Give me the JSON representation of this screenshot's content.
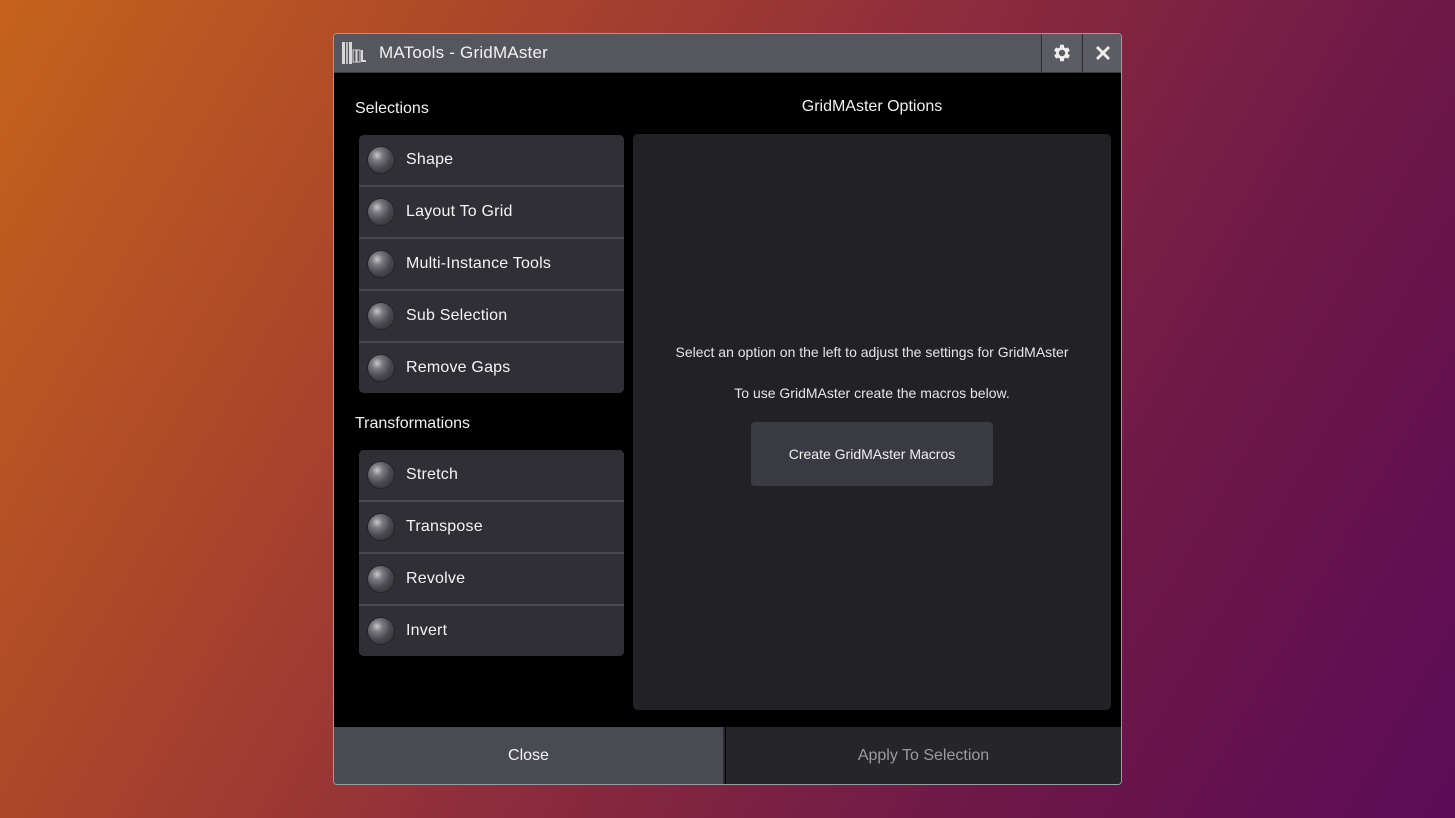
{
  "window": {
    "title": "MATools - GridMAster",
    "logo_icon": "matools-logo-icon",
    "settings_icon": "gear-icon",
    "close_icon": "close-icon"
  },
  "selections": {
    "heading": "Selections",
    "items": [
      {
        "label": "Shape",
        "icon": "radio-ball-icon"
      },
      {
        "label": "Layout To Grid",
        "icon": "radio-ball-icon"
      },
      {
        "label": "Multi-Instance Tools",
        "icon": "radio-ball-icon"
      },
      {
        "label": "Sub Selection",
        "icon": "radio-ball-icon"
      },
      {
        "label": "Remove Gaps",
        "icon": "radio-ball-icon"
      }
    ]
  },
  "transformations": {
    "heading": "Transformations",
    "items": [
      {
        "label": "Stretch",
        "icon": "radio-ball-icon"
      },
      {
        "label": "Transpose",
        "icon": "radio-ball-icon"
      },
      {
        "label": "Revolve",
        "icon": "radio-ball-icon"
      },
      {
        "label": "Invert",
        "icon": "radio-ball-icon"
      }
    ]
  },
  "options": {
    "heading": "GridMAster Options",
    "info_line_1": "Select an option on the left to adjust the settings for GridMAster",
    "info_line_2": "To use GridMAster create the macros below.",
    "create_macros_label": "Create GridMAster Macros"
  },
  "footer": {
    "close_label": "Close",
    "apply_label": "Apply To Selection"
  },
  "colors": {
    "title_bar": "#56565e",
    "window_bg": "#000000",
    "list_item_bg": "#2f2f35",
    "options_panel_bg": "#222226",
    "close_button_bg": "#4a4a52",
    "apply_button_text_disabled": "#9a9aa0"
  }
}
